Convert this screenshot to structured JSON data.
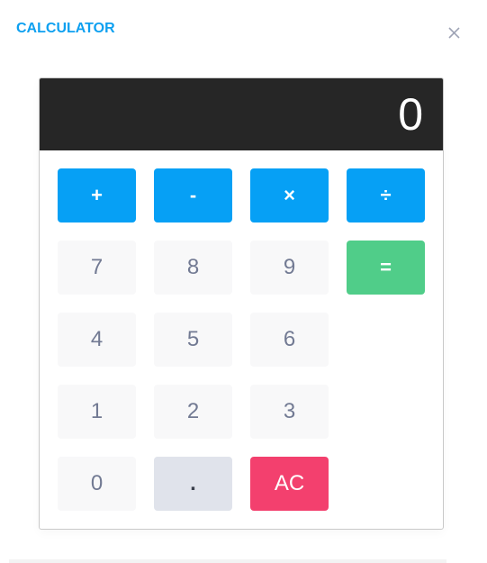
{
  "header": {
    "title": "CALCULATOR",
    "close_icon": "close-icon"
  },
  "calculator": {
    "display_value": "0",
    "operators": [
      {
        "label": "+",
        "name": "add"
      },
      {
        "label": "-",
        "name": "subtract"
      },
      {
        "label": "×",
        "name": "multiply"
      },
      {
        "label": "÷",
        "name": "divide"
      }
    ],
    "digits": {
      "seven": "7",
      "eight": "8",
      "nine": "9",
      "four": "4",
      "five": "5",
      "six": "6",
      "one": "1",
      "two": "2",
      "three": "3",
      "zero": "0"
    },
    "equals_label": "=",
    "decimal_label": ".",
    "clear_label": "AC"
  },
  "colors": {
    "accent": "#0ea0f0",
    "operator": "#06a0f5",
    "equals": "#50cd89",
    "clear": "#f3406e",
    "display_bg": "#262626",
    "digit_bg": "#f8f8f9",
    "digit_text": "#727a93"
  }
}
